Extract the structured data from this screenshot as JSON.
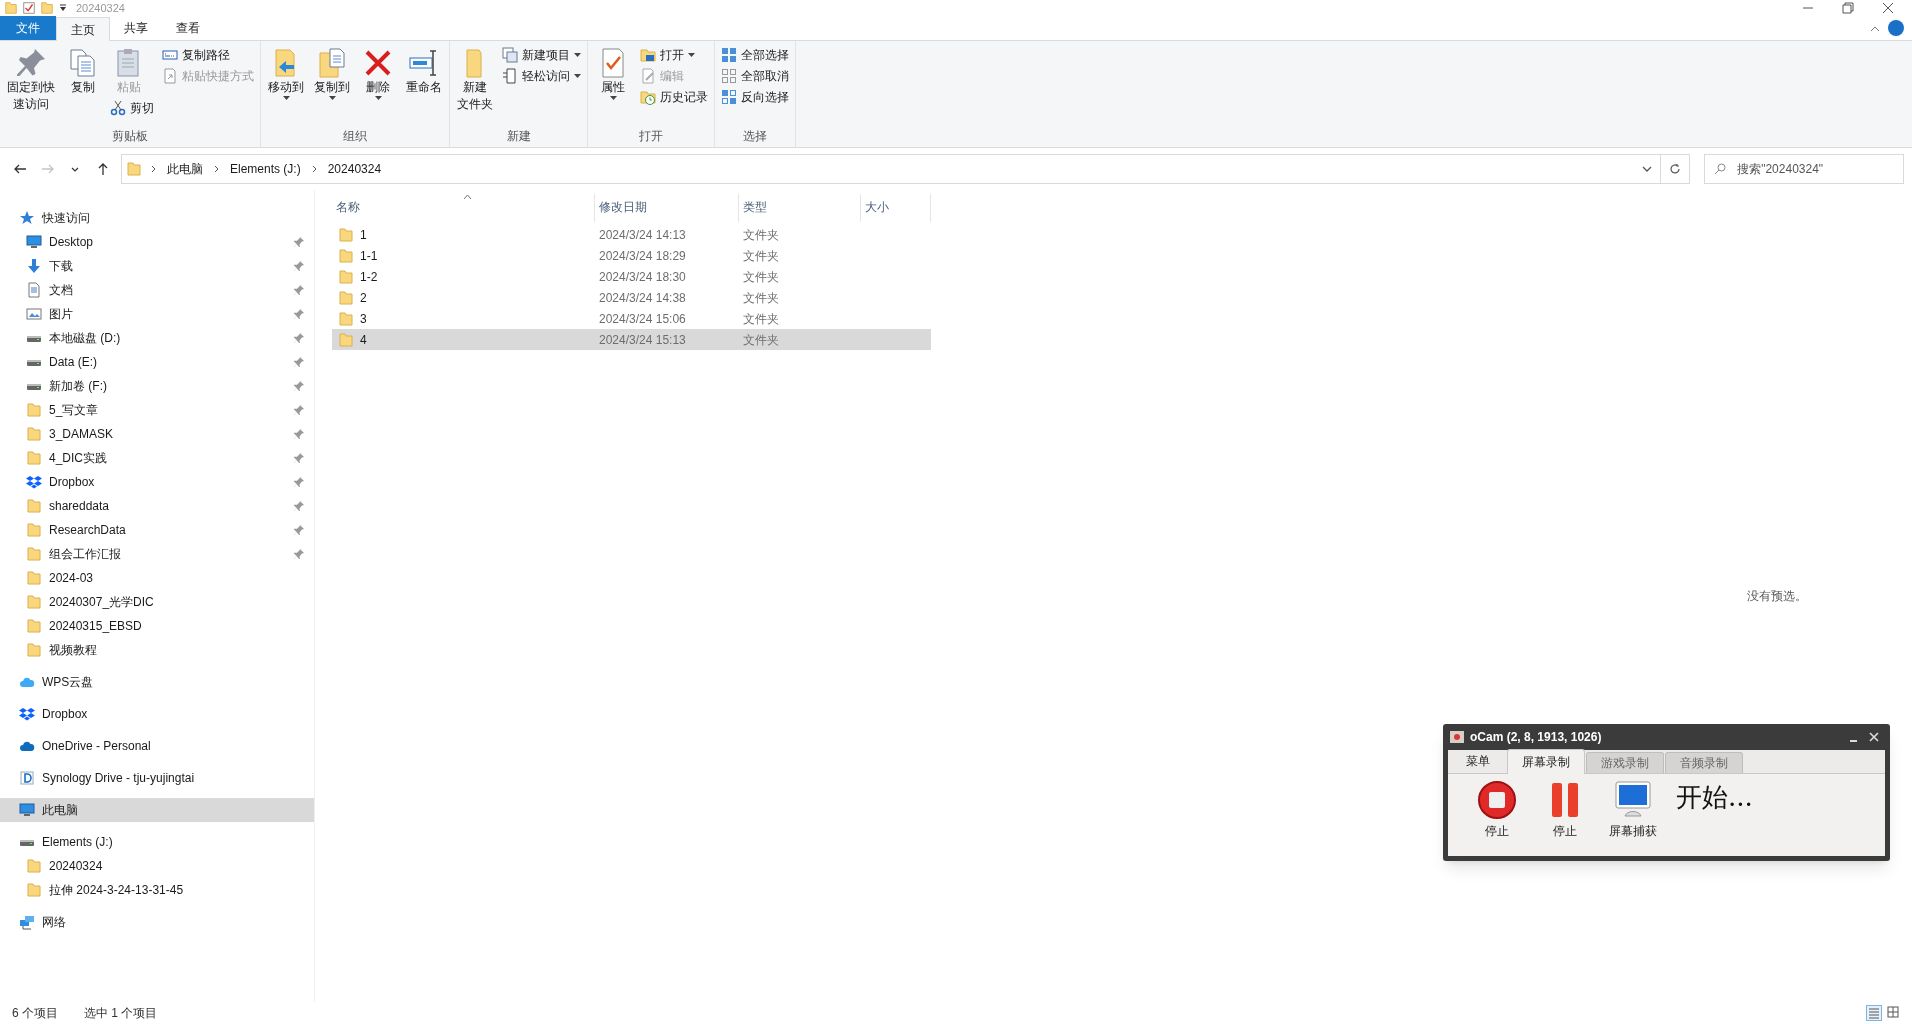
{
  "title_bar": {
    "title": "20240324"
  },
  "ribbon_tabs": [
    {
      "label": "文件",
      "kind": "file",
      "selected": false
    },
    {
      "label": "主页",
      "kind": "tab",
      "selected": true
    },
    {
      "label": "共享",
      "kind": "tab",
      "selected": false
    },
    {
      "label": "查看",
      "kind": "tab",
      "selected": false
    }
  ],
  "ribbon": {
    "groups": [
      {
        "label": "剪贴板",
        "columns": [
          [
            {
              "lines": [
                "固定到快",
                "速访问"
              ],
              "kind": "large",
              "disabled": false,
              "dropdown": false
            }
          ],
          [
            {
              "label": "复制",
              "kind": "large",
              "disabled": false,
              "dropdown": false
            }
          ],
          [
            {
              "label": "粘贴",
              "kind": "large",
              "disabled": true,
              "dropdown": false
            },
            {
              "label": "剪切",
              "kind": "small",
              "disabled": false,
              "dropdown": false
            }
          ],
          [
            {
              "label": "复制路径",
              "kind": "small",
              "disabled": false,
              "dropdown": false
            },
            {
              "label": "粘贴快捷方式",
              "kind": "small",
              "disabled": true,
              "dropdown": false
            }
          ]
        ]
      },
      {
        "label": "组织",
        "columns": [
          [
            {
              "label": "移动到",
              "kind": "large",
              "disabled": false,
              "dropdown": true
            }
          ],
          [
            {
              "label": "复制到",
              "kind": "large",
              "disabled": false,
              "dropdown": true
            }
          ],
          [
            {
              "label": "删除",
              "kind": "large",
              "disabled": false,
              "dropdown": true
            }
          ],
          [
            {
              "label": "重命名",
              "kind": "large",
              "disabled": false,
              "dropdown": false
            }
          ]
        ]
      },
      {
        "label": "新建",
        "columns": [
          [
            {
              "lines": [
                "新建",
                "文件夹"
              ],
              "kind": "large",
              "disabled": false,
              "dropdown": false
            }
          ],
          [
            {
              "label": "新建项目",
              "kind": "small",
              "disabled": false,
              "dropdown": true
            },
            {
              "label": "轻松访问",
              "kind": "small",
              "disabled": false,
              "dropdown": true
            }
          ]
        ]
      },
      {
        "label": "打开",
        "columns": [
          [
            {
              "label": "属性",
              "kind": "large",
              "disabled": false,
              "dropdown": true
            }
          ],
          [
            {
              "label": "打开",
              "kind": "small",
              "disabled": false,
              "dropdown": true
            },
            {
              "label": "编辑",
              "kind": "small",
              "disabled": true,
              "dropdown": false
            },
            {
              "label": "历史记录",
              "kind": "small",
              "disabled": false,
              "dropdown": false
            }
          ]
        ]
      },
      {
        "label": "选择",
        "columns": [
          [
            {
              "label": "全部选择",
              "kind": "small",
              "disabled": false,
              "dropdown": false
            },
            {
              "label": "全部取消",
              "kind": "small",
              "disabled": false,
              "dropdown": false
            },
            {
              "label": "反向选择",
              "kind": "small",
              "disabled": false,
              "dropdown": false
            }
          ]
        ]
      }
    ]
  },
  "address_bar": {
    "nav_buttons": [
      {
        "kind": "back",
        "disabled": false
      },
      {
        "kind": "forward",
        "disabled": true
      },
      {
        "kind": "recent",
        "disabled": false
      },
      {
        "kind": "up",
        "disabled": false
      }
    ],
    "breadcrumbs": [
      "此电脑",
      "Elements (J:)",
      "20240324"
    ]
  },
  "search": {
    "placeholder": "搜索\"20240324\""
  },
  "navigation_pane": {
    "items": [
      {
        "label": "快速访问",
        "kind": "star",
        "selected": false,
        "children": [
          {
            "label": "Desktop",
            "kind": "desktop",
            "pinned": true,
            "selected": false
          },
          {
            "label": "下载",
            "kind": "download",
            "pinned": true,
            "selected": false
          },
          {
            "label": "文档",
            "kind": "document",
            "pinned": true,
            "selected": false
          },
          {
            "label": "图片",
            "kind": "picture",
            "pinned": true,
            "selected": false
          },
          {
            "label": "本地磁盘 (D:)",
            "kind": "drive",
            "pinned": true,
            "selected": false
          },
          {
            "label": "Data (E:)",
            "kind": "drive",
            "pinned": true,
            "selected": false
          },
          {
            "label": "新加卷 (F:)",
            "kind": "drive",
            "pinned": true,
            "selected": false
          },
          {
            "label": "5_写文章",
            "kind": "folder",
            "pinned": true,
            "selected": false
          },
          {
            "label": "3_DAMASK",
            "kind": "folder",
            "pinned": true,
            "selected": false
          },
          {
            "label": "4_DIC实践",
            "kind": "folder",
            "pinned": true,
            "selected": false
          },
          {
            "label": "Dropbox",
            "kind": "boxes",
            "pinned": true,
            "selected": false
          },
          {
            "label": "shareddata",
            "kind": "folder",
            "pinned": true,
            "selected": false
          },
          {
            "label": "ResearchData",
            "kind": "folder",
            "pinned": true,
            "selected": false
          },
          {
            "label": "组会工作汇报",
            "kind": "folder",
            "pinned": true,
            "selected": false
          },
          {
            "label": "2024-03",
            "kind": "folder",
            "pinned": false,
            "selected": false
          },
          {
            "label": "20240307_光学DIC",
            "kind": "folder",
            "pinned": false,
            "selected": false
          },
          {
            "label": "20240315_EBSD",
            "kind": "folder",
            "pinned": false,
            "selected": false
          },
          {
            "label": "视频教程",
            "kind": "folder",
            "pinned": false,
            "selected": false
          }
        ]
      },
      {
        "label": "WPS云盘",
        "kind": "cloud",
        "selected": false
      },
      {
        "label": "Dropbox",
        "kind": "boxes",
        "selected": false
      },
      {
        "label": "OneDrive - Personal",
        "kind": "cloud2",
        "selected": false
      },
      {
        "label": "Synology Drive - tju-yujingtai",
        "kind": "dapp",
        "selected": false
      },
      {
        "label": "此电脑",
        "kind": "desktop",
        "selected": true
      },
      {
        "label": "Elements (J:)",
        "kind": "drive",
        "selected": false,
        "children": [
          {
            "label": "20240324",
            "kind": "folder",
            "pinned": false,
            "selected": false
          },
          {
            "label": "拉伸 2024-3-24-13-31-45",
            "kind": "folder",
            "pinned": false,
            "selected": false
          }
        ]
      },
      {
        "label": "网络",
        "kind": "network",
        "selected": false
      }
    ]
  },
  "file_list": {
    "columns": [
      {
        "label": "名称",
        "sorted": true
      },
      {
        "label": "修改日期",
        "sorted": false
      },
      {
        "label": "类型",
        "sorted": false
      },
      {
        "label": "大小",
        "sorted": false
      }
    ],
    "rows": [
      {
        "name": "1",
        "modified": "2024/3/24 14:13",
        "type": "文件夹",
        "selected": false
      },
      {
        "name": "1-1",
        "modified": "2024/3/24 18:29",
        "type": "文件夹",
        "selected": false
      },
      {
        "name": "1-2",
        "modified": "2024/3/24 18:30",
        "type": "文件夹",
        "selected": false
      },
      {
        "name": "2",
        "modified": "2024/3/24 14:38",
        "type": "文件夹",
        "selected": false
      },
      {
        "name": "3",
        "modified": "2024/3/24 15:06",
        "type": "文件夹",
        "selected": false
      },
      {
        "name": "4",
        "modified": "2024/3/24 15:13",
        "type": "文件夹",
        "selected": true
      }
    ]
  },
  "preview": {
    "message": "没有预选。"
  },
  "status_bar": {
    "item_count": "6 个项目",
    "selection": "选中 1 个项目"
  },
  "ocam": {
    "title": "oCam (2, 8, 1913, 1026)",
    "tabs": [
      {
        "label": "菜单",
        "kind": "menu",
        "selected": false
      },
      {
        "label": "屏幕录制",
        "kind": "tab",
        "selected": true
      },
      {
        "label": "游戏录制",
        "kind": "tab",
        "selected": false
      },
      {
        "label": "音频录制",
        "kind": "tab",
        "selected": false
      }
    ],
    "buttons": [
      {
        "label": "停止",
        "kind": "stop"
      },
      {
        "label": "停止",
        "kind": "pause"
      },
      {
        "label": "屏幕捕获",
        "kind": "screen"
      }
    ],
    "status": "开始..."
  }
}
